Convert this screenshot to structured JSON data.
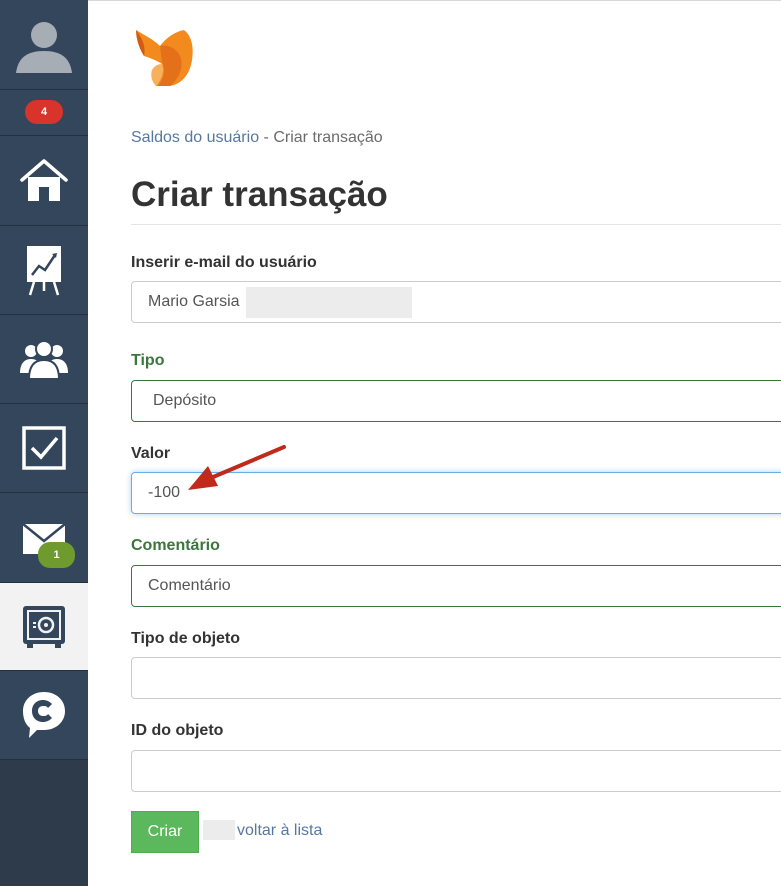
{
  "sidebar": {
    "notifications_badge": "4",
    "messages_badge": "1",
    "items": [
      {
        "icon": "avatar-icon"
      },
      {
        "icon": "home-icon"
      },
      {
        "icon": "chart-presentation-icon"
      },
      {
        "icon": "users-group-icon"
      },
      {
        "icon": "checkbox-icon"
      },
      {
        "icon": "mail-icon"
      },
      {
        "icon": "safe-icon",
        "active": true
      },
      {
        "icon": "chat-c-icon"
      }
    ]
  },
  "breadcrumb": {
    "parent": "Saldos do usuário",
    "separator": "-",
    "current": "Criar transação"
  },
  "page_title": "Criar transação",
  "form": {
    "email_label": "Inserir e-mail do usuário",
    "email_value": "Mario Garsia",
    "type_label": "Tipo",
    "type_value": "Depósito",
    "amount_label": "Valor",
    "amount_value": "-100",
    "comment_label": "Comentário",
    "comment_placeholder": "Comentário",
    "object_type_label": "Tipo de objeto",
    "object_type_value": "",
    "object_id_label": "ID do objeto",
    "object_id_value": "",
    "create_button": "Criar",
    "back_link": "voltar à lista"
  },
  "colors": {
    "sidebar_bg": "#33465c",
    "accent_green": "#5cb85c",
    "label_green": "#3c763d",
    "link_blue": "#5578a0",
    "annotation_arrow": "#c0291c"
  }
}
